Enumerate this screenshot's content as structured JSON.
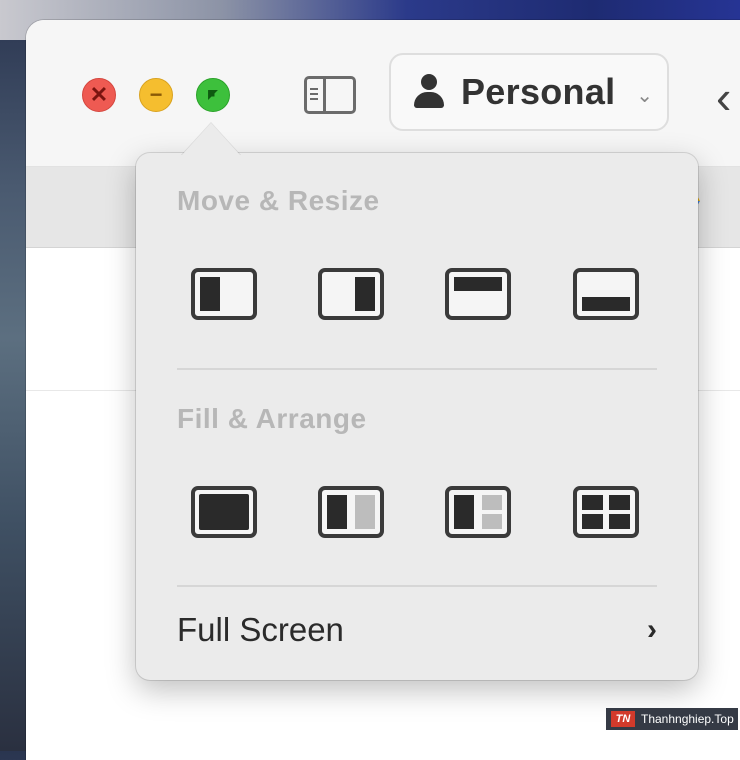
{
  "toolbar": {
    "profile_label": "Personal"
  },
  "menu": {
    "move_resize_title": "Move & Resize",
    "fill_arrange_title": "Fill & Arrange",
    "full_screen_label": "Full Screen",
    "move_resize_items": [
      "tile-left",
      "tile-right",
      "tile-top",
      "tile-bottom"
    ],
    "fill_arrange_items": [
      "fill",
      "split-halves",
      "one-plus-two",
      "quarters"
    ]
  },
  "colors": {
    "close": "#ee5a52",
    "minimize": "#f5be2f",
    "zoom": "#3dc03c",
    "menu_bg": "#ebebeb",
    "section_title": "#b7b7b7"
  },
  "watermark": {
    "logo": "TN",
    "text": "Thanhnghiep.Top"
  }
}
